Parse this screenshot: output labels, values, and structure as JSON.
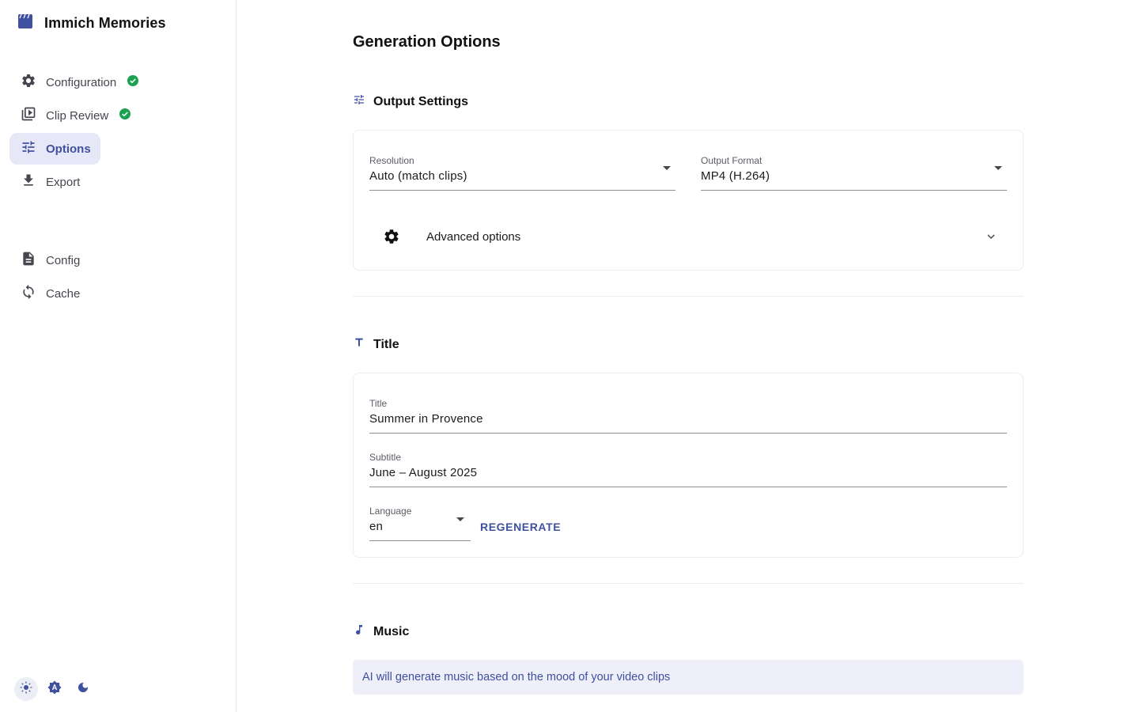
{
  "app": {
    "title": "Immich Memories"
  },
  "sidebar": {
    "items": [
      {
        "label": "Configuration",
        "icon": "gear-icon",
        "completed": true,
        "active": false
      },
      {
        "label": "Clip Review",
        "icon": "video-library-icon",
        "completed": true,
        "active": false
      },
      {
        "label": "Options",
        "icon": "tune-icon",
        "completed": false,
        "active": true
      },
      {
        "label": "Export",
        "icon": "download-icon",
        "completed": false,
        "active": false
      }
    ],
    "secondary_items": [
      {
        "label": "Config",
        "icon": "document-icon"
      },
      {
        "label": "Cache",
        "icon": "sync-icon"
      }
    ],
    "theme_modes": [
      "light",
      "auto",
      "dark"
    ],
    "theme_selected": "light"
  },
  "page": {
    "title": "Generation Options"
  },
  "output_settings": {
    "title": "Output Settings",
    "resolution": {
      "label": "Resolution",
      "value": "Auto (match clips)"
    },
    "format": {
      "label": "Output Format",
      "value": "MP4 (H.264)"
    },
    "advanced_label": "Advanced options"
  },
  "title_section": {
    "title": "Title",
    "title_field": {
      "label": "Title",
      "value": "Summer in Provence"
    },
    "subtitle_field": {
      "label": "Subtitle",
      "value": "June – August 2025"
    },
    "language": {
      "label": "Language",
      "value": "en"
    },
    "regenerate_label": "REGENERATE"
  },
  "music": {
    "title": "Music",
    "info": "AI will generate music based on the mood of your video clips"
  },
  "colors": {
    "accent": "#4050a0",
    "success": "#1aa251",
    "nav_active_bg": "#e7e8f7",
    "info_bg": "#eeeff8"
  }
}
